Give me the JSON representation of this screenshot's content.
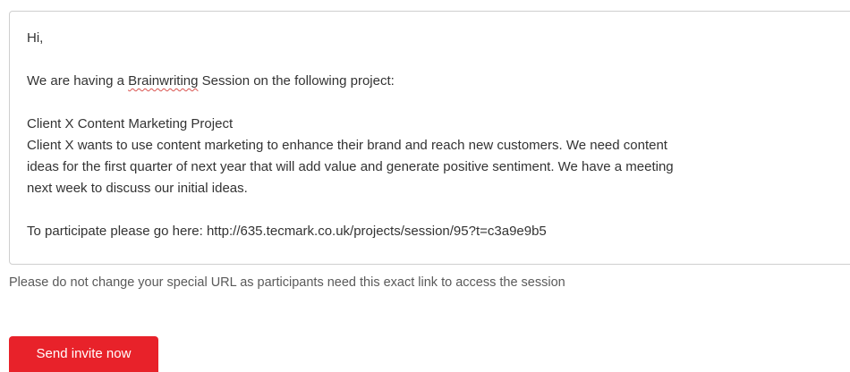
{
  "message": {
    "greeting": "Hi,",
    "intro_before": "We are having a ",
    "intro_spell": "Brainwriting",
    "intro_after": " Session on the following project:",
    "project_title": "Client X Content Marketing Project",
    "description_lines": [
      "Client X wants to use content marketing to enhance their brand and reach new customers. We need content",
      "ideas for the first quarter of next year that will add value and generate positive sentiment. We have a meeting",
      "next week to discuss our initial ideas."
    ],
    "participate_line": "To participate please go here: http://635.tecmark.co.uk/projects/session/95?t=c3a9e9b5"
  },
  "help_text": "Please do not change your special URL as participants need this exact link to access the session",
  "send_button_label": "Send invite now",
  "colors": {
    "button": "#e8222a",
    "field_label": "#e07b2a",
    "border": "#cfcfcf"
  }
}
